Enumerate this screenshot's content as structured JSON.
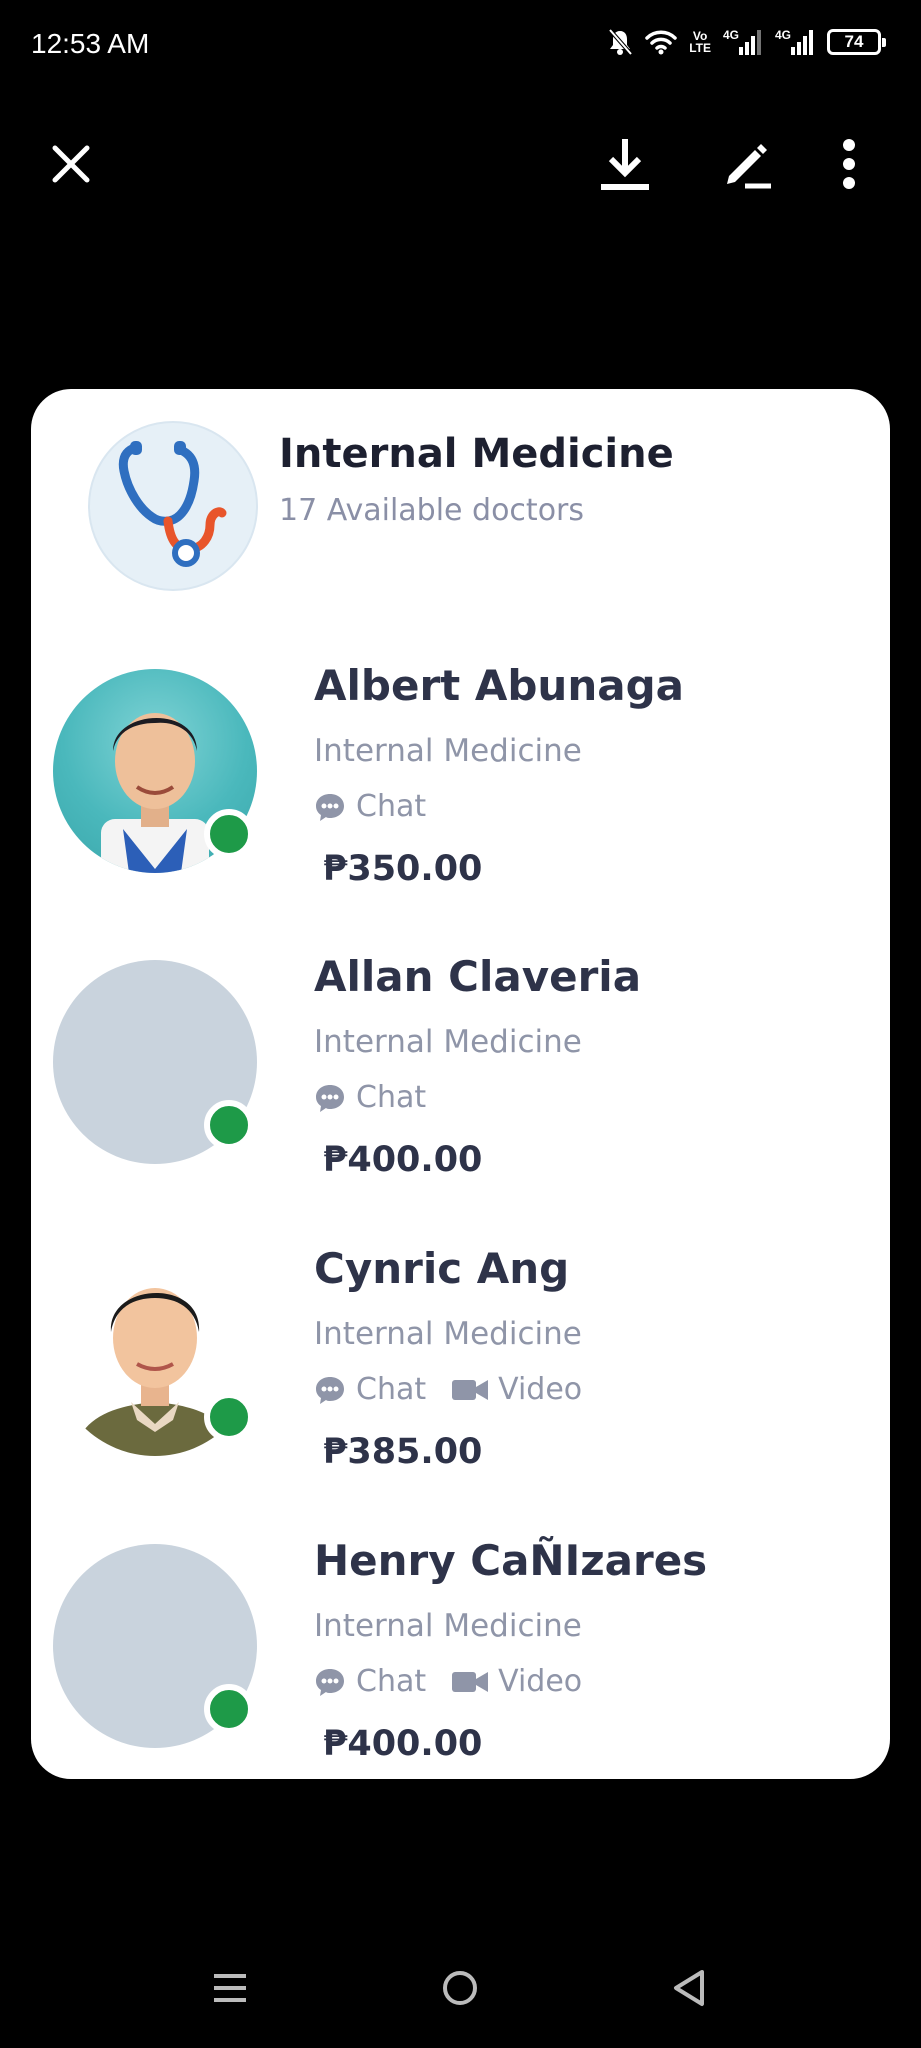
{
  "status_bar": {
    "time": "12:53 AM",
    "volte_top": "Vo",
    "volte_bottom": "LTE",
    "net1": "4G",
    "net2": "4G",
    "battery": "74"
  },
  "header": {
    "title": "Internal Medicine",
    "subtitle": "17 Available doctors",
    "icon": "stethoscope-icon"
  },
  "doctors": [
    {
      "name": "Albert Abunaga",
      "specialty": "Internal Medicine",
      "chat_label": "Chat",
      "video_label": "",
      "price": "₱350.00",
      "online": true
    },
    {
      "name": "Allan Claveria",
      "specialty": "Internal Medicine",
      "chat_label": "Chat",
      "video_label": "",
      "price": "₱400.00",
      "online": true
    },
    {
      "name": "Cynric Ang",
      "specialty": "Internal Medicine",
      "chat_label": "Chat",
      "video_label": "Video",
      "price": "₱385.00",
      "online": true
    },
    {
      "name": "Henry CaÑIzares",
      "specialty": "Internal Medicine",
      "chat_label": "Chat",
      "video_label": "Video",
      "price": "₱400.00",
      "online": true
    }
  ],
  "colors": {
    "online": "#1e9a48",
    "text_dark": "#2e3349",
    "text_muted": "#8f95a8",
    "placeholder_avatar": "#c9d3dd",
    "stethoscope_blue": "#2f6fc0",
    "stethoscope_orange": "#e8552b"
  },
  "toolbar_icons": [
    "close-icon",
    "download-icon",
    "edit-icon",
    "more-vert-icon"
  ],
  "nav_icons": [
    "recents-icon",
    "home-icon",
    "back-icon"
  ]
}
